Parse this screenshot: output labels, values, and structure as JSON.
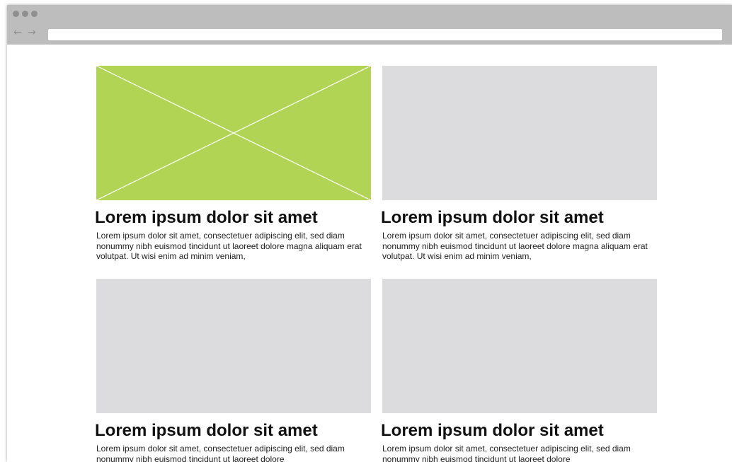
{
  "browser": {
    "back_icon": "arrow-left-icon",
    "forward_icon": "arrow-right-icon",
    "back_glyph": "←",
    "forward_glyph": "→",
    "address": ""
  },
  "colors": {
    "chrome": "#bdbdbd",
    "placeholder_accent": "#b1d455",
    "image_gray": "#dcdbde"
  },
  "cards": [
    {
      "image": "placeholder-x",
      "title": "Lorem ipsum dolor sit amet",
      "body": "Lorem ipsum dolor sit amet, consectetuer adipiscing elit, sed diam nonummy nibh euismod tincidunt ut laoreet dolore magna aliquam erat volutpat. Ut wisi enim ad minim veniam,"
    },
    {
      "image": "gray",
      "title": "Lorem ipsum dolor sit amet",
      "body": "Lorem ipsum dolor sit amet, consectetuer adipiscing elit, sed diam nonummy nibh euismod tincidunt ut laoreet dolore magna aliquam erat volutpat. Ut wisi enim ad minim veniam,"
    },
    {
      "image": "gray",
      "title": "Lorem ipsum dolor sit amet",
      "body": "Lorem ipsum dolor sit amet, consectetuer adipiscing elit, sed diam nonummy nibh euismod tincidunt ut laoreet dolore"
    },
    {
      "image": "gray",
      "title": "Lorem ipsum dolor sit amet",
      "body": "Lorem ipsum dolor sit amet, consectetuer adipiscing elit, sed diam nonummy nibh euismod tincidunt ut laoreet dolore"
    }
  ]
}
